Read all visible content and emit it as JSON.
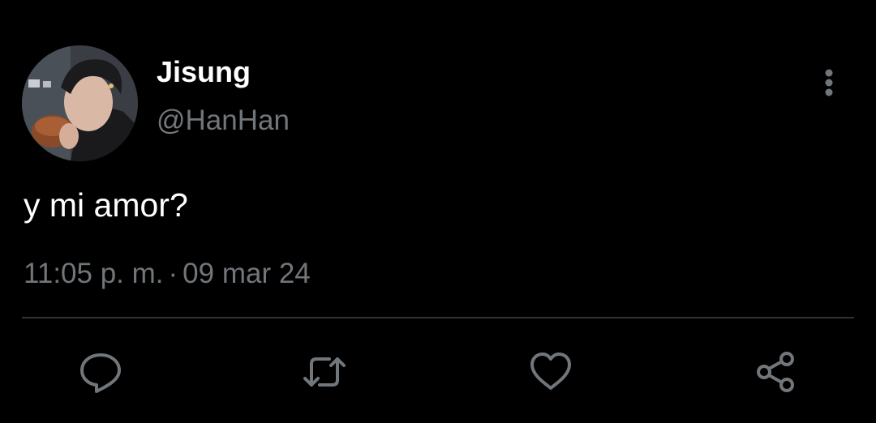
{
  "tweet": {
    "author": {
      "display_name": "Jisung",
      "handle": "@HanHan",
      "avatar_icon": "profile-photo"
    },
    "text": "y mi amor?",
    "time": "11:05 p. m.",
    "separator": "·",
    "date": "09 mar 24",
    "more_icon": "more-vertical-icon"
  },
  "actions": [
    {
      "name": "reply",
      "icon": "reply-icon"
    },
    {
      "name": "retweet",
      "icon": "retweet-icon"
    },
    {
      "name": "like",
      "icon": "heart-icon"
    },
    {
      "name": "share",
      "icon": "share-icon"
    }
  ],
  "colors": {
    "background": "#000000",
    "primary_text": "#ffffff",
    "secondary_text": "#71767b",
    "divider": "#2f3336",
    "icon": "#71767b"
  }
}
